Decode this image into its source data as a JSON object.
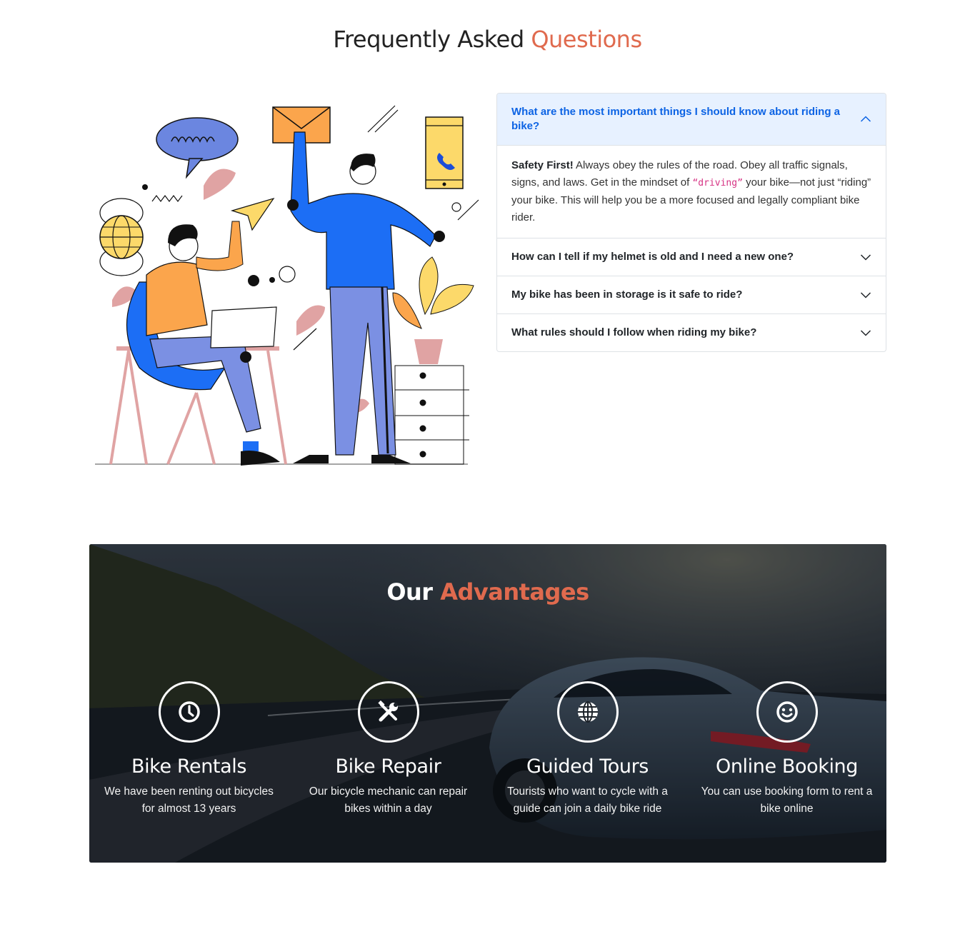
{
  "faq": {
    "title_main": "Frequently Asked ",
    "title_accent": "Questions",
    "items": [
      {
        "question": "What are the most important things I should know about riding a bike?",
        "open": true,
        "answer_bold": "Safety First!",
        "answer_part1": " Always obey the rules of the road. Obey all traffic signals, signs, and laws. Get in the mindset of ",
        "answer_code": "“driving”",
        "answer_part2": " your bike—not just “riding” your bike. This will help you be a more focused and legally compliant bike rider."
      },
      {
        "question": "How can I tell if my helmet is old and I need a new one?",
        "open": false
      },
      {
        "question": "My bike has been in storage is it safe to ride?",
        "open": false
      },
      {
        "question": "What rules should I follow when riding my bike?",
        "open": false
      }
    ]
  },
  "advantages": {
    "title_main": "Our ",
    "title_accent": "Advantages",
    "items": [
      {
        "icon": "clock-icon",
        "name": "Bike Rentals",
        "desc": "We have been renting out bicycles for almost 13 years"
      },
      {
        "icon": "tools-icon",
        "name": "Bike Repair",
        "desc": "Our bicycle mechanic can repair bikes within a day"
      },
      {
        "icon": "globe-icon",
        "name": "Guided Tours",
        "desc": "Tourists who want to cycle with a guide can join a daily bike ride"
      },
      {
        "icon": "smile-icon",
        "name": "Online Booking",
        "desc": "You can use booking form to rent a bike online"
      }
    ]
  },
  "colors": {
    "accent": "#e06a4e",
    "accordion_active_bg": "#e7f1ff",
    "accordion_active_text": "#0c63e4"
  }
}
